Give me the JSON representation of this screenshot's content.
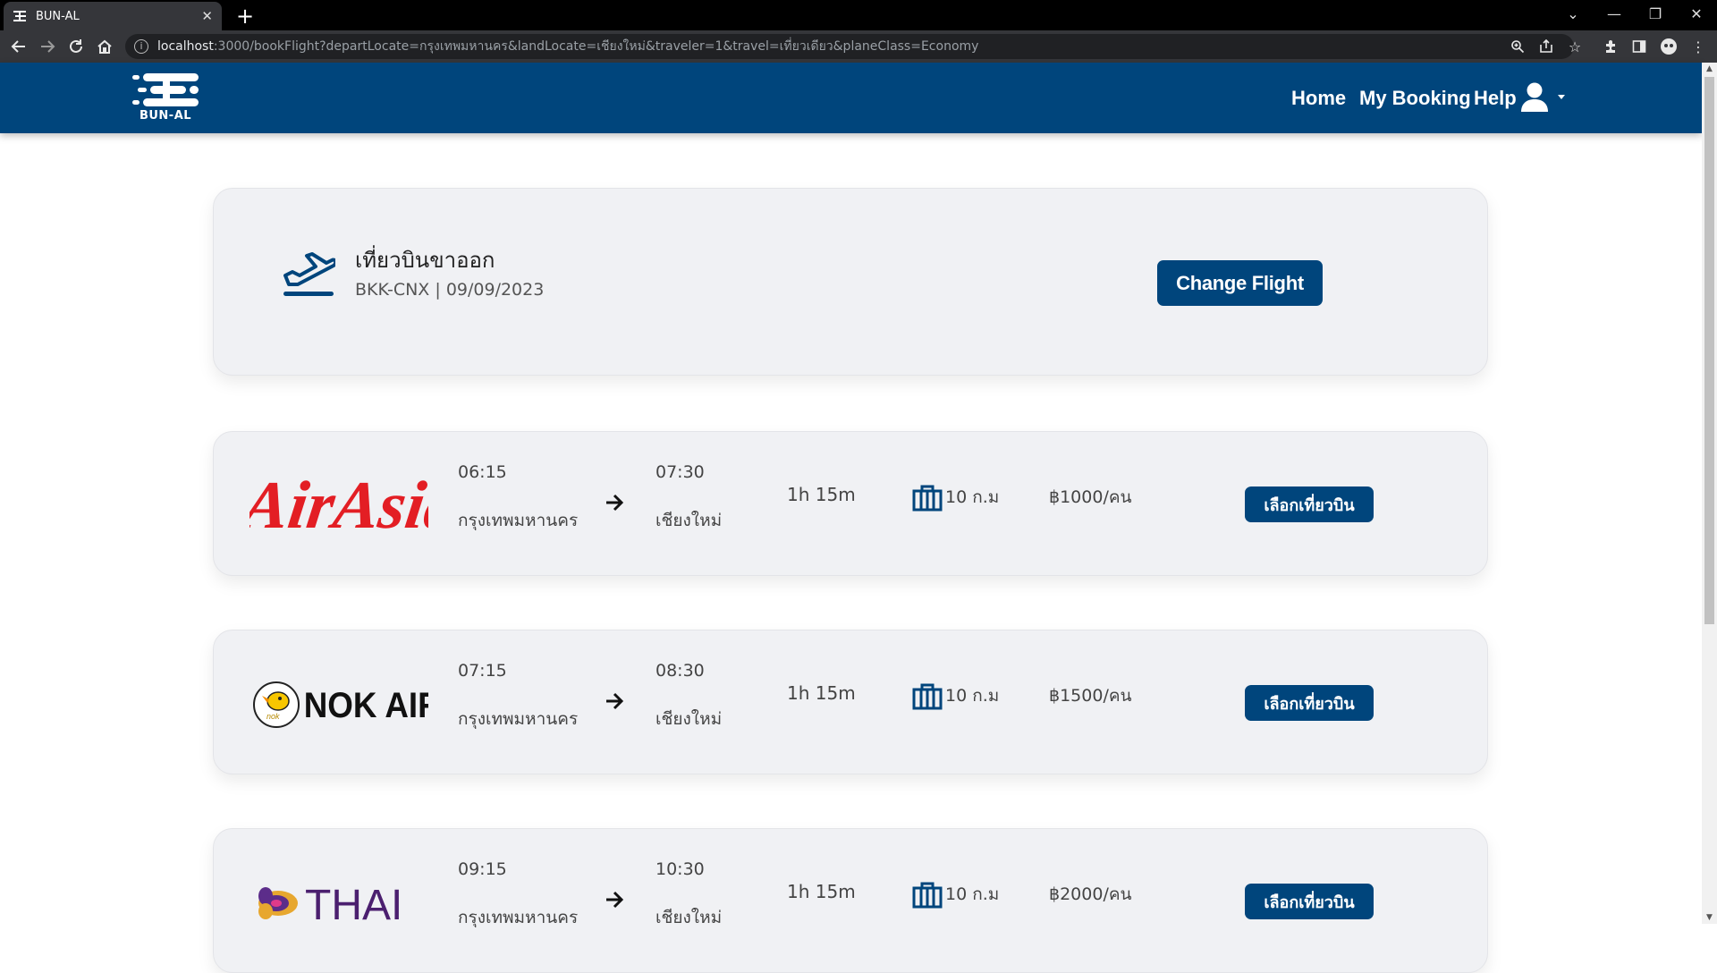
{
  "browser": {
    "tab_title": "BUN-AL",
    "url_host": "localhost",
    "url_path": ":3000/bookFlight?departLocate=กรุงเทพมหานคร&landLocate=เชียงใหม่&traveler=1&travel=เที่ยวเดียว&planeClass=Economy"
  },
  "header": {
    "logo_text": "BUN-AL",
    "nav": {
      "home": "Home",
      "my_booking": "My Booking",
      "help": "Help"
    },
    "brand_color": "#00457c"
  },
  "summary": {
    "title": "เที่ยวบินขาออก",
    "route": "BKK-CNX",
    "separator": "|",
    "date": "09/09/2023",
    "change_button": "Change Flight"
  },
  "flights": [
    {
      "airline": "AirAsia",
      "depart_time": "06:15",
      "depart_city": "กรุงเทพมหานคร",
      "arrive_time": "07:30",
      "arrive_city": "เชียงใหม่",
      "duration": "1h 15m",
      "baggage": "10 ก.ม",
      "price": "฿1000/คน",
      "select_label": "เลือกเที่ยวบิน"
    },
    {
      "airline": "NOK AIR",
      "depart_time": "07:15",
      "depart_city": "กรุงเทพมหานคร",
      "arrive_time": "08:30",
      "arrive_city": "เชียงใหม่",
      "duration": "1h 15m",
      "baggage": "10 ก.ม",
      "price": "฿1500/คน",
      "select_label": "เลือกเที่ยวบิน"
    },
    {
      "airline": "THAI",
      "depart_time": "09:15",
      "depart_city": "กรุงเทพมหานคร",
      "arrive_time": "10:30",
      "arrive_city": "เชียงใหม่",
      "duration": "1h 15m",
      "baggage": "10 ก.ม",
      "price": "฿2000/คน",
      "select_label": "เลือกเที่ยวบิน"
    }
  ],
  "icons": {
    "tab": "airline-logo-favicon",
    "summary": "plane-takeoff-icon",
    "arrow": "arrow-right-icon",
    "baggage": "baggage-icon",
    "user": "user-icon"
  }
}
